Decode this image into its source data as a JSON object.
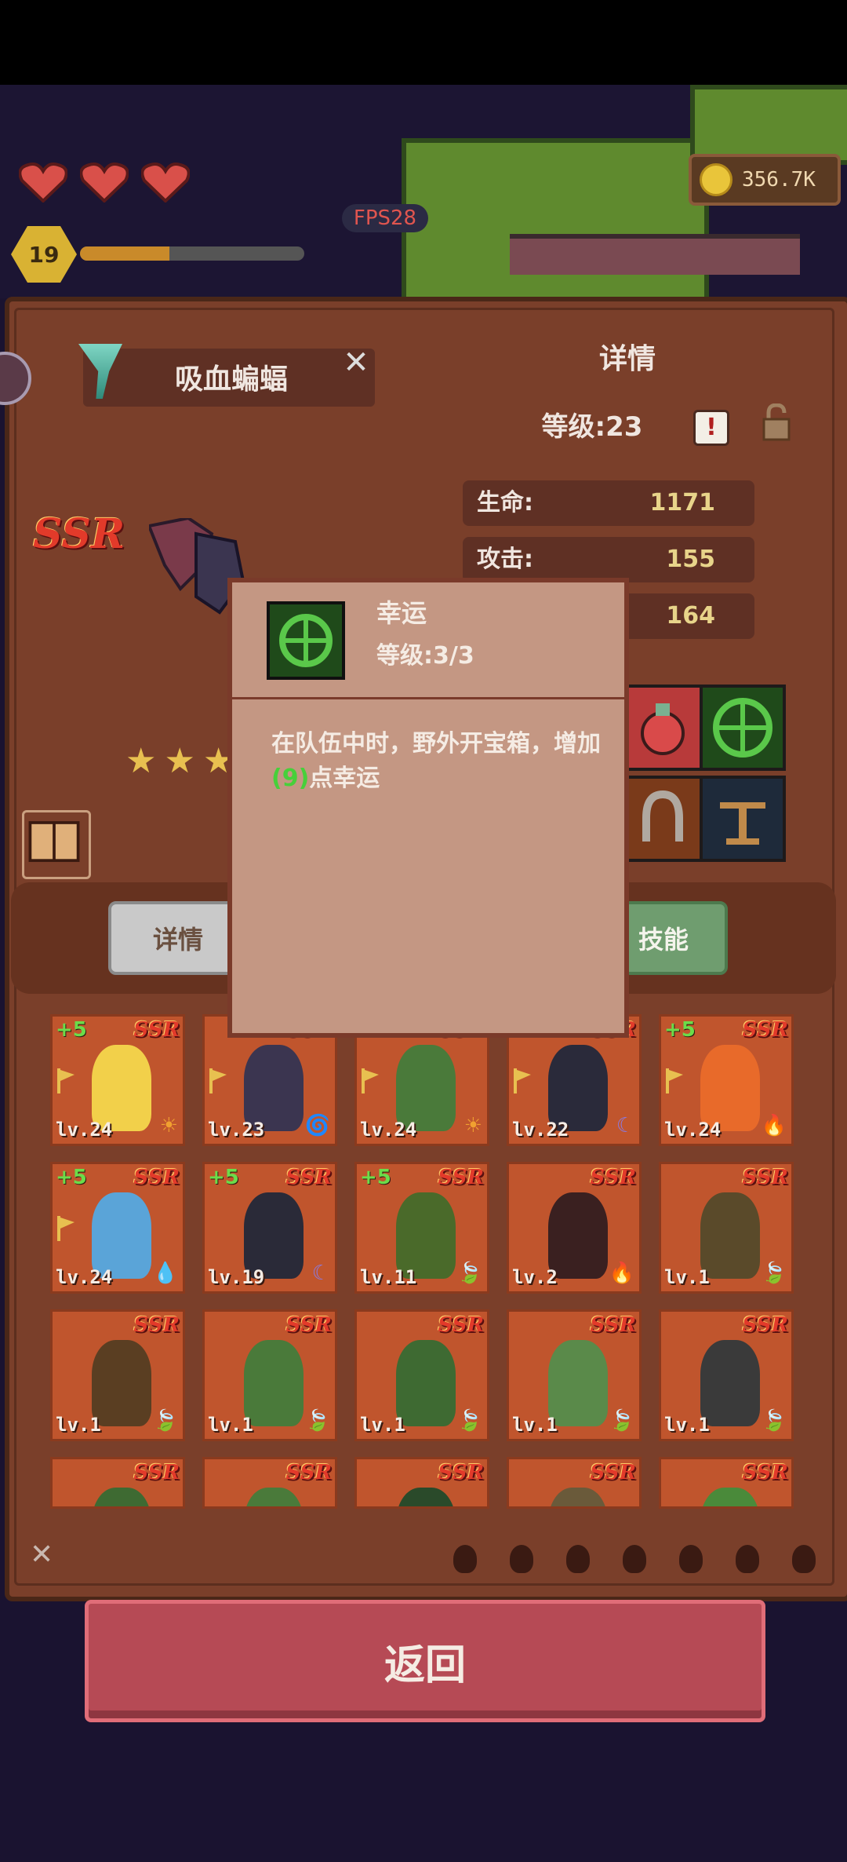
{
  "hud": {
    "hearts": 3,
    "player_level": "19",
    "xp_progress": 0.4,
    "fps": "FPS28",
    "coins": "356.7K"
  },
  "panel": {
    "pet_name": "吸血蝙蝠",
    "details_title": "详情",
    "level_label": "等级:23",
    "rarity": "SSR",
    "star_count": 3,
    "stats": [
      {
        "label": "生命:",
        "value": "1171"
      },
      {
        "label": "攻击:",
        "value": "155"
      },
      {
        "label": "",
        "value": "164"
      }
    ],
    "tabs": {
      "details": "详情",
      "skills": "技能"
    }
  },
  "popup": {
    "skill_name": "幸运",
    "skill_level": "等级:3/3",
    "desc_before": "在队伍中时，野外开宝箱，增加",
    "desc_value": "(9)",
    "desc_after": "点幸运"
  },
  "grid": [
    {
      "plus": "+5",
      "rarity": "SSR",
      "level": "lv.24",
      "flag": true,
      "element": "sun-icon",
      "color": "#f2d04a"
    },
    {
      "plus": "",
      "rarity": "SSR",
      "level": "lv.23",
      "flag": true,
      "element": "tornado-icon",
      "color": "#3b3550"
    },
    {
      "plus": "",
      "rarity": "SSR",
      "level": "lv.24",
      "flag": true,
      "element": "sun-icon",
      "color": "#4a7a3a"
    },
    {
      "plus": "",
      "rarity": "SSR",
      "level": "lv.22",
      "flag": true,
      "element": "moon-icon",
      "color": "#2a2a3a"
    },
    {
      "plus": "+5",
      "rarity": "SSR",
      "level": "lv.24",
      "flag": true,
      "element": "fire-icon",
      "color": "#e86a2a"
    },
    {
      "plus": "+5",
      "rarity": "SSR",
      "level": "lv.24",
      "flag": true,
      "element": "water-icon",
      "color": "#5aa4d8"
    },
    {
      "plus": "+5",
      "rarity": "SSR",
      "level": "lv.19",
      "flag": false,
      "element": "moon-icon",
      "color": "#2a2a38"
    },
    {
      "plus": "+5",
      "rarity": "SSR",
      "level": "lv.11",
      "flag": false,
      "element": "leaf-icon",
      "color": "#4a6a2a"
    },
    {
      "plus": "",
      "rarity": "SSR",
      "level": "lv.2",
      "flag": false,
      "element": "fire-icon",
      "color": "#3a2020"
    },
    {
      "plus": "",
      "rarity": "SSR",
      "level": "lv.1",
      "flag": false,
      "element": "leaf-icon",
      "color": "#5a4a2a"
    },
    {
      "plus": "",
      "rarity": "SSR",
      "level": "lv.1",
      "flag": false,
      "element": "leaf-icon",
      "color": "#5a3e22"
    },
    {
      "plus": "",
      "rarity": "SSR",
      "level": "lv.1",
      "flag": false,
      "element": "leaf-icon",
      "color": "#4a7a3a"
    },
    {
      "plus": "",
      "rarity": "SSR",
      "level": "lv.1",
      "flag": false,
      "element": "leaf-icon",
      "color": "#3e6a32"
    },
    {
      "plus": "",
      "rarity": "SSR",
      "level": "lv.1",
      "flag": false,
      "element": "leaf-icon",
      "color": "#5a8a4a"
    },
    {
      "plus": "",
      "rarity": "SSR",
      "level": "lv.1",
      "flag": false,
      "element": "leaf-icon",
      "color": "#3a3a3a"
    },
    {
      "plus": "",
      "rarity": "SSR",
      "level": "",
      "flag": false,
      "element": "",
      "color": "#3e6a32"
    },
    {
      "plus": "",
      "rarity": "SSR",
      "level": "",
      "flag": false,
      "element": "",
      "color": "#4a7a3a"
    },
    {
      "plus": "",
      "rarity": "SSR",
      "level": "",
      "flag": false,
      "element": "",
      "color": "#2a4a2a"
    },
    {
      "plus": "",
      "rarity": "SSR",
      "level": "",
      "flag": false,
      "element": "",
      "color": "#6a5a3a"
    },
    {
      "plus": "",
      "rarity": "SSR",
      "level": "",
      "flag": false,
      "element": "",
      "color": "#4a8a3a"
    }
  ],
  "filters": [
    "leaf-filter-icon",
    "earth-filter-icon",
    "water-filter-icon",
    "wind-filter-icon",
    "fire-filter-icon",
    "gear-filter-icon",
    "refresh-filter-icon"
  ],
  "back_button": "返回"
}
